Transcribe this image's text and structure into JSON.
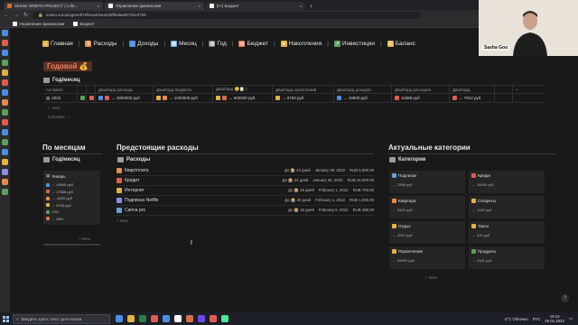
{
  "browser": {
    "tabs": [
      {
        "label": "Stream ORBITA PROJECT | Lofe...",
        "favicon_color": "#e8672a"
      },
      {
        "label": "Управление финансами",
        "favicon_color": "#ffffff"
      },
      {
        "label": "[H-] Бюджет",
        "favicon_color": "#ffffff"
      }
    ],
    "url": "notion.so/oologres/97ef5ca4cbea439ffedaed6724c8783",
    "bookmarks": [
      {
        "label": "Управление финансами",
        "color": "#ffffff"
      },
      {
        "label": "Бюджет",
        "color": "#ffffff"
      }
    ]
  },
  "webcam": {
    "caption": "Sasha Goo"
  },
  "nav": [
    {
      "label": "Главная",
      "icon": "home-icon",
      "color": "#e3b341"
    },
    {
      "label": "Расходы",
      "icon": "coins-icon",
      "color": "#e58a4b"
    },
    {
      "label": "Доходы",
      "icon": "income-icon",
      "color": "#4b8fe5"
    },
    {
      "label": "Месяц",
      "icon": "calendar-icon",
      "color": "#6aa0e6"
    },
    {
      "label": "Год",
      "icon": "calendar-icon",
      "color": "#c9c9c9"
    },
    {
      "label": "Бюджет",
      "icon": "ledger-icon",
      "color": "#d86c4b"
    },
    {
      "label": "Накопления",
      "icon": "savings-icon",
      "color": "#e3b341"
    },
    {
      "label": "Инвестиции",
      "icon": "chart-icon",
      "color": "#5aa05a"
    },
    {
      "label": "Баланс",
      "icon": "scale-icon",
      "color": "#e3b341"
    }
  ],
  "banner": "Годовой 💰",
  "year_section": {
    "title": "Год/месяц",
    "columns": [
      "Aa Name",
      "",
      "",
      "Дашборд расходы",
      "Дашборд бюджета",
      "Дашборд 😊📋⚠",
      "Дашборд накоплений",
      "Дашборд доходов",
      "Дашборд расходов",
      "Дашборд",
      "",
      "+"
    ],
    "row": {
      "name": "2022",
      "values": [
        "→ 1800000 руб",
        "→ 1200000 руб",
        "→ 600000 руб",
        "→ 9750 руб",
        "→ 19500 руб",
        "11588 руб",
        "→ 7912 руб"
      ]
    },
    "new_label": "New",
    "calculate_label": "Calculate"
  },
  "months_section": {
    "title": "По месяцам",
    "sub": "Год/месяц",
    "card": {
      "title": "Январь",
      "rows": [
        "→ 19500 руб",
        "→ 17588 руб",
        "→ -8000 руб",
        "→ 9750 руб",
        "13%",
        "→ 28%"
      ]
    },
    "new_label": "New"
  },
  "upcoming_section": {
    "title": "Предстоящие расходы",
    "sub": "Расходы",
    "rows": [
      {
        "name": "Квартплата",
        "icon": "house-icon",
        "color": "#e58a4b",
        "due": "До 🎰 24 дней",
        "date": "January 28, 2022",
        "amount": "RUB 5,500.00"
      },
      {
        "name": "Кредит",
        "icon": "bank-icon",
        "color": "#e25c4b",
        "due": "До 🎰 24 дней",
        "date": "January 30, 2022",
        "amount": "RUB 16,000.00"
      },
      {
        "name": "Интернет",
        "icon": "globe-icon",
        "color": "#e3b341",
        "due": "До 🎰 26 дней",
        "date": "February 1, 2022",
        "amount": "RUB 700.00"
      },
      {
        "name": "Подписка Netflix",
        "icon": "tv-icon",
        "color": "#8a8fe8",
        "due": "До 🎰 26 дней",
        "date": "February 1, 2022",
        "amount": "RUB 1,000.00"
      },
      {
        "name": "Canva pro",
        "icon": "palette-icon",
        "color": "#6a9bd8",
        "due": "До 🎰 30 дней",
        "date": "February 5, 2022",
        "amount": "RUB 499.00"
      }
    ],
    "new_label": "New"
  },
  "categories_section": {
    "title": "Актуальные категории",
    "sub": "Категории",
    "cards": [
      {
        "name": "Подписки",
        "value": "2898 руб",
        "color": "#6a9bd8"
      },
      {
        "name": "Кредит",
        "value": "16000 руб",
        "color": "#e25c4b"
      },
      {
        "name": "Квартира",
        "value": "5500 руб",
        "color": "#e58a4b"
      },
      {
        "name": "Сигареты",
        "value": "1198 руб",
        "color": "#e3b341"
      },
      {
        "name": "Отдых",
        "value": "4510 руб",
        "color": "#e3b341"
      },
      {
        "name": "Такси",
        "value": "500 руб",
        "color": "#e3b341"
      },
      {
        "name": "Развлечения",
        "value": "59699 руб",
        "color": "#e3b341"
      },
      {
        "name": "Продукты",
        "value": "4181 руб",
        "color": "#5aa05a"
      }
    ],
    "new_label": "New"
  },
  "taskbar": {
    "search_placeholder": "Введите здесь текст для поиска",
    "weather": "-4°C  Облачно",
    "lang": "РУС",
    "time": "19:19",
    "date": "05.01.2022",
    "app_colors": [
      "#4b8fe5",
      "#e3b341",
      "#2d7d46",
      "#e25c4b",
      "#4b8fe5",
      "#ffffff",
      "#d86c4b",
      "#6a4be5",
      "#e25c4b",
      "#4be59b"
    ]
  }
}
